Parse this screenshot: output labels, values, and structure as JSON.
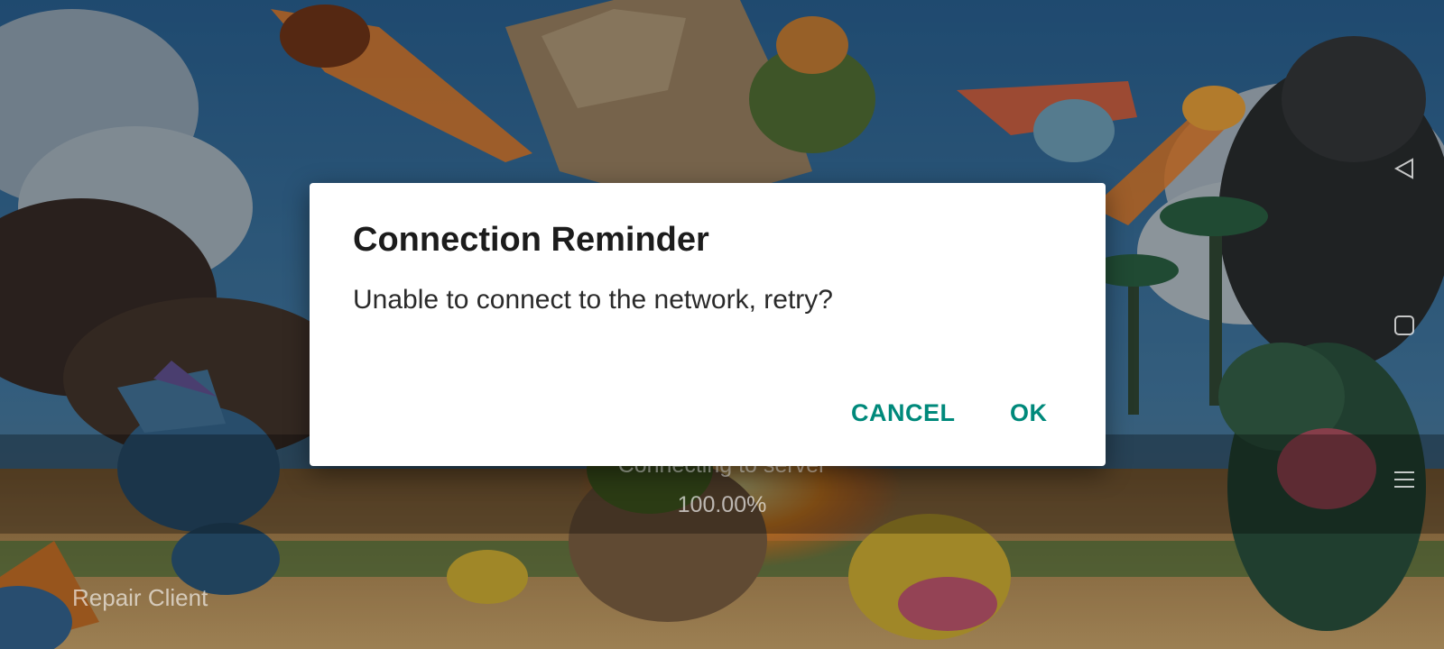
{
  "dialog": {
    "title": "Connection Reminder",
    "message": "Unable to connect to the network, retry?",
    "cancel_label": "CANCEL",
    "ok_label": "OK",
    "accent_color": "#00897b"
  },
  "loading": {
    "status": "Connecting to server",
    "percent": "100.00%"
  },
  "footer": {
    "repair_label": "Repair Client"
  },
  "system_nav": {
    "icons": [
      "back-icon",
      "home-icon",
      "menu-icon"
    ]
  }
}
